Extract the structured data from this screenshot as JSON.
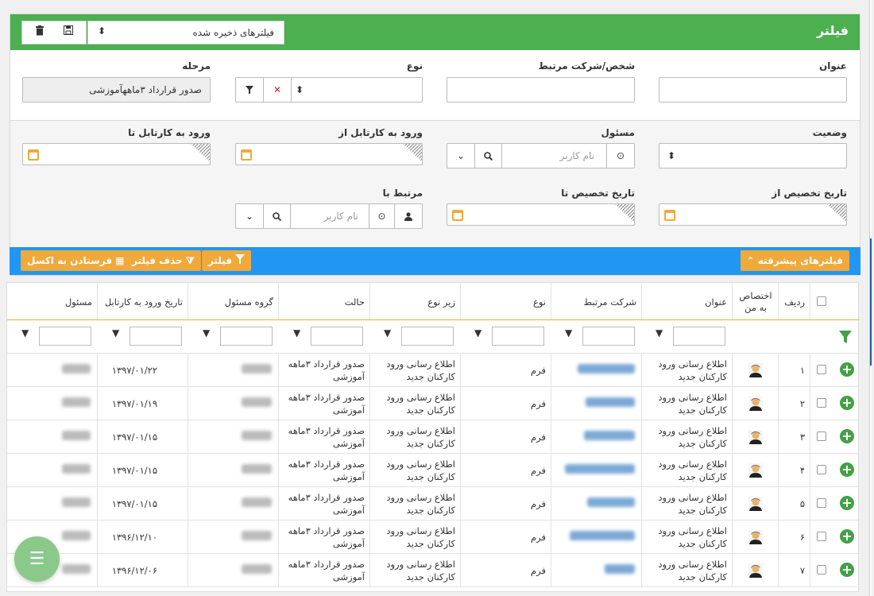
{
  "header": {
    "title": "فیلتر",
    "saved_filters_label": "فیلترهای ذخیره شده"
  },
  "fields": {
    "title_label": "عنوان",
    "related_label": "شخص/شرکت مرتبط",
    "type_label": "نوع",
    "stage_label": "مرحله",
    "stage_value": "صدور قرارداد ۳ماههآموزشی",
    "status_label": "وضعیت",
    "responsible_label": "مسئول",
    "user_placeholder": "نام کاربر",
    "cartable_from_label": "ورود به کارتابل از",
    "cartable_to_label": "ورود به کارتابل تا",
    "assign_from_label": "تاریخ تخصیص از",
    "assign_to_label": "تاریخ تخصیص تا",
    "related_with_label": "مرتبط با"
  },
  "toolbar": {
    "advanced_label": "فیلترهای پیشرفته",
    "filter_label": "فیلتر",
    "remove_filter_label": "حذف فیلتر",
    "excel_label": "فرستادن به اکسل"
  },
  "table": {
    "headers": {
      "row": "ردیف",
      "assigned_1": "اختصاص",
      "assigned_2": "به من",
      "title": "عنوان",
      "company": "شرکت مرتبط",
      "type": "نوع",
      "subtype": "زیر نوع",
      "state": "حالت",
      "group": "گروه مسئول",
      "date": "تاریخ ورود به کارتابل",
      "owner": "مسئول"
    },
    "rows": [
      {
        "num": "۱",
        "title1": "اطلاع رسانی ورود",
        "title2": "کارکنان جدید",
        "type": "فرم",
        "sub1": "اطلاع رسانی ورود",
        "sub2": "کارکنان جدید",
        "state1": "صدور قرارداد ۳ماهه",
        "state2": "آموزشی",
        "date": "۱۳۹۷/۰۱/۲۲"
      },
      {
        "num": "۲",
        "title1": "اطلاع رسانی ورود",
        "title2": "کارکنان جدید",
        "type": "فرم",
        "sub1": "اطلاع رسانی ورود",
        "sub2": "کارکنان جدید",
        "state1": "صدور قرارداد ۳ماهه",
        "state2": "آموزشی",
        "date": "۱۳۹۷/۰۱/۱۹"
      },
      {
        "num": "۳",
        "title1": "اطلاع رسانی ورود",
        "title2": "کارکنان جدید",
        "type": "فرم",
        "sub1": "اطلاع رسانی ورود",
        "sub2": "کارکنان جدید",
        "state1": "صدور قرارداد ۳ماهه",
        "state2": "آموزشی",
        "date": "۱۳۹۷/۰۱/۱۵"
      },
      {
        "num": "۴",
        "title1": "اطلاع رسانی ورود",
        "title2": "کارکنان جدید",
        "type": "فرم",
        "sub1": "اطلاع رسانی ورود",
        "sub2": "کارکنان جدید",
        "state1": "صدور قرارداد ۳ماهه",
        "state2": "آموزشی",
        "date": "۱۳۹۷/۰۱/۱۵"
      },
      {
        "num": "۵",
        "title1": "اطلاع رسانی ورود",
        "title2": "کارکنان جدید",
        "type": "فرم",
        "sub1": "اطلاع رسانی ورود",
        "sub2": "کارکنان جدید",
        "state1": "صدور قرارداد ۳ماهه",
        "state2": "آموزشی",
        "date": "۱۳۹۷/۰۱/۱۵"
      },
      {
        "num": "۶",
        "title1": "اطلاع رسانی ورود",
        "title2": "کارکنان جدید",
        "type": "فرم",
        "sub1": "اطلاع رسانی ورود",
        "sub2": "کارکنان جدید",
        "state1": "صدور قرارداد ۳ماهه",
        "state2": "آموزشی",
        "date": "۱۳۹۶/۱۲/۱۰"
      },
      {
        "num": "۷",
        "title1": "اطلاع رسانی ورود",
        "title2": "کارکنان جدید",
        "type": "فرم",
        "sub1": "اطلاع رسانی ورود",
        "sub2": "کارکنان جدید",
        "state1": "صدور قرارداد ۳ماهه",
        "state2": "آموزشی",
        "date": "۱۳۹۶/۱۲/۰۶"
      }
    ]
  },
  "icons": {
    "delete": "trash-icon",
    "save": "save-icon",
    "sort": "sort-arrows-icon",
    "funnel": "funnel-icon",
    "calendar": "calendar-icon",
    "search": "search-icon",
    "user": "user-icon",
    "menu": "menu-icon"
  },
  "colors": {
    "header_green": "#4caf50",
    "toolbar_blue": "#2196f3",
    "button_orange": "#f0a93b",
    "plus_green": "#43a047",
    "fab_green": "#8bc98b"
  }
}
